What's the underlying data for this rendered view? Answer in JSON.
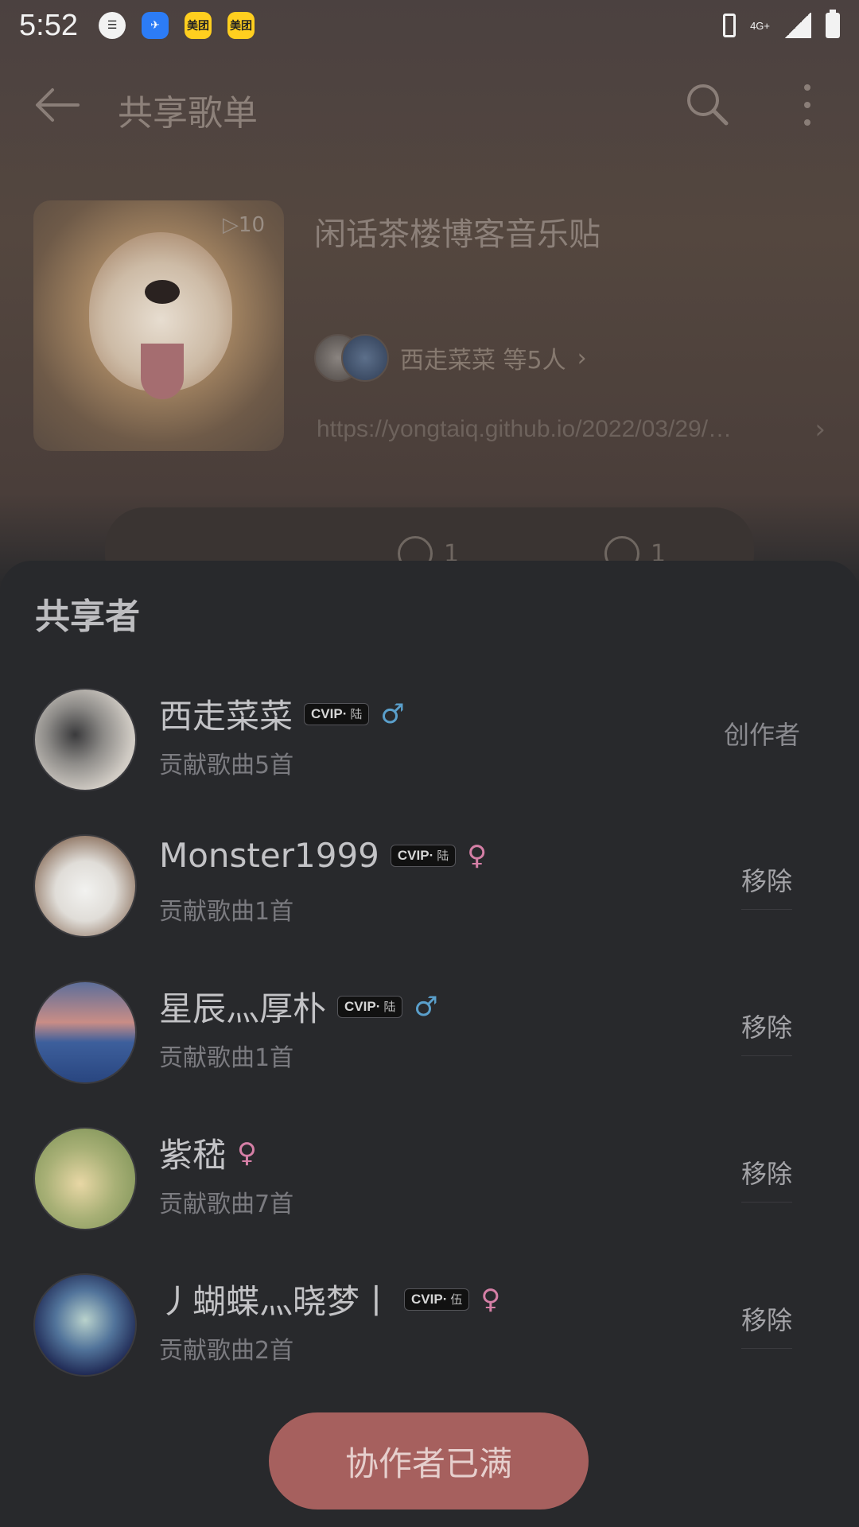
{
  "status_bar": {
    "time": "5:52",
    "app_icons": [
      "message-icon",
      "dingtalk-icon",
      "meituan-icon",
      "meituan-icon"
    ],
    "meituan_label": "美团",
    "network": "4G+"
  },
  "topbar": {
    "title": "共享歌单"
  },
  "playlist": {
    "play_count": "▷10",
    "title": "闲话茶楼博客音乐贴",
    "sharers": "西走菜菜 等5人",
    "url": "https://yongtaiq.github.io/2022/03/29/…",
    "comments": "1",
    "shares": "1"
  },
  "sheet": {
    "title": "共享者",
    "members": [
      {
        "name": "西走菜菜",
        "vip": true,
        "vip_level": "陆",
        "gender": "male",
        "gender_symbol": "♂",
        "contribution": "贡献歌曲5首",
        "action": "创作者",
        "avatar_colors": "#8d8b88"
      },
      {
        "name": "Monster1999",
        "vip": true,
        "vip_level": "陆",
        "gender": "female",
        "gender_symbol": "♀",
        "contribution": "贡献歌曲1首",
        "action": "移除"
      },
      {
        "name": "星辰灬厚朴",
        "vip": true,
        "vip_level": "陆",
        "gender": "male",
        "gender_symbol": "♂",
        "contribution": "贡献歌曲1首",
        "action": "移除"
      },
      {
        "name": "紫嵇",
        "vip": false,
        "gender": "female",
        "gender_symbol": "♀",
        "contribution": "贡献歌曲7首",
        "action": "移除"
      },
      {
        "name": "丿蝴蝶灬晓梦丨",
        "vip": true,
        "vip_level": "伍",
        "gender": "female",
        "gender_symbol": "♀",
        "contribution": "贡献歌曲2首",
        "action": "移除"
      }
    ],
    "vip_text": "CVIP·",
    "full_button": "协作者已满"
  },
  "colors": {
    "accent": "#a6605e",
    "male": "#5a9fcb",
    "female": "#d57fa6",
    "sheet_bg": "#28292c"
  }
}
